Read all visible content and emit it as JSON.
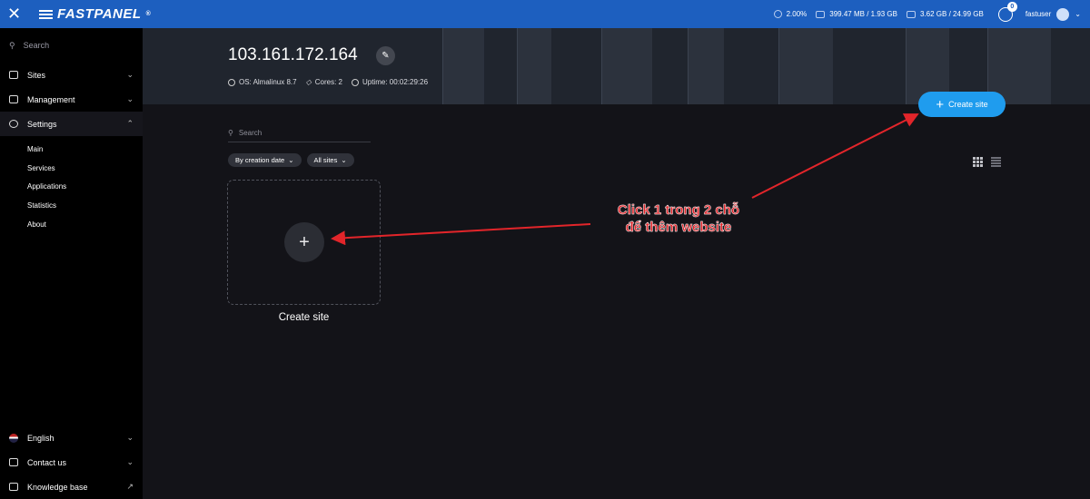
{
  "topbar": {
    "brand": "FASTPANEL",
    "brand_mark": "®",
    "cpu": "2.00%",
    "ram": "399.47 MB / 1.93 GB",
    "disk": "3.62 GB / 24.99 GB",
    "notifications": "0",
    "user": "fastuser"
  },
  "sidebar": {
    "search_placeholder": "Search",
    "items": [
      {
        "label": "Sites"
      },
      {
        "label": "Management"
      },
      {
        "label": "Settings"
      }
    ],
    "settings_sub": [
      "Main",
      "Services",
      "Applications",
      "Statistics",
      "About"
    ],
    "bottom": [
      {
        "label": "English"
      },
      {
        "label": "Contact us"
      },
      {
        "label": "Knowledge base"
      }
    ]
  },
  "server": {
    "ip": "103.161.172.164",
    "os": "OS: Almalinux 8.7",
    "cores": "Cores: 2",
    "uptime": "Uptime: 00:02:29:26"
  },
  "main": {
    "create_button": "Create site",
    "search_placeholder": "Search",
    "filter_sort": "By creation date",
    "filter_sites": "All sites",
    "card_label": "Create site"
  },
  "annotation": {
    "line1": "Click 1 trong 2 chỗ",
    "line2": "để thêm website",
    "color": "#e2252a"
  }
}
